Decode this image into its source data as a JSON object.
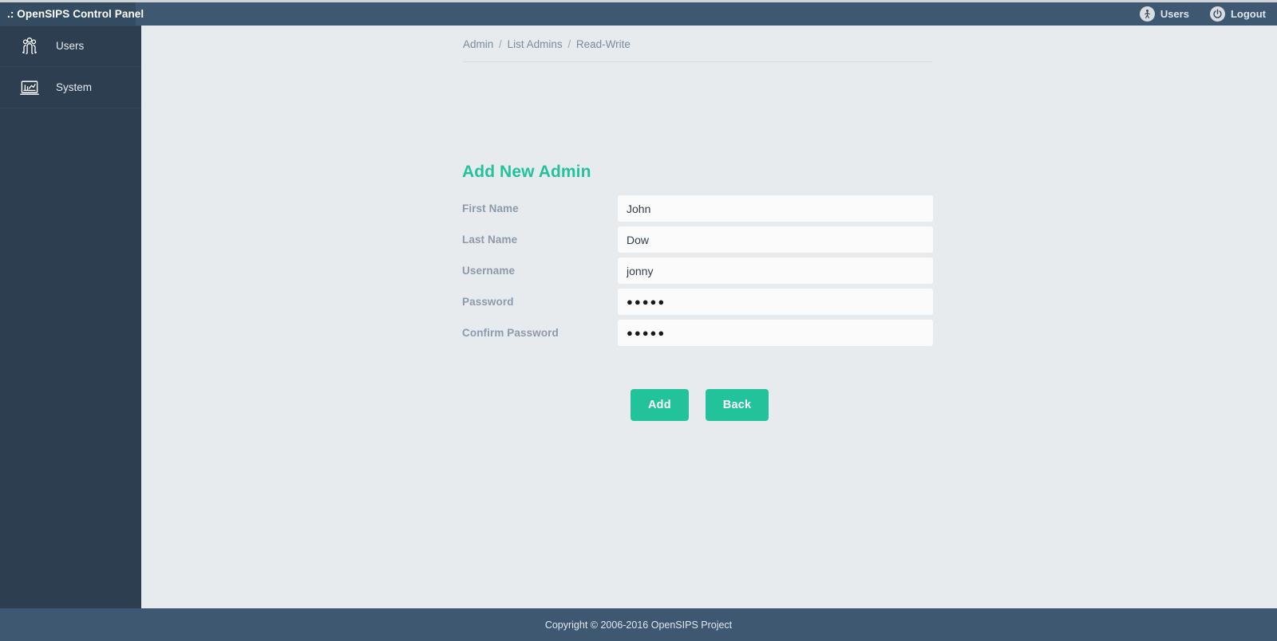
{
  "header": {
    "brand": ".: OpenSIPS Control Panel",
    "users_label": "Users",
    "users_icon": "person-icon",
    "logout_label": "Logout",
    "logout_icon": "power-icon",
    "background_color": "#3d5870",
    "brand_background_color": "#344c61"
  },
  "sidebar": {
    "background_color": "#2c3e50",
    "items": [
      {
        "label": "Users",
        "icon": "users-group-icon"
      },
      {
        "label": "System",
        "icon": "monitor-chart-icon"
      }
    ]
  },
  "breadcrumb": {
    "items": [
      "Admin",
      "List Admins",
      "Read-Write"
    ],
    "separator": "/"
  },
  "main": {
    "title": "Add New Admin",
    "accent_color": "#22c29b",
    "fields": [
      {
        "label": "First Name",
        "value": "John",
        "type": "text",
        "placeholder": ""
      },
      {
        "label": "Last Name",
        "value": "Dow",
        "type": "text",
        "placeholder": ""
      },
      {
        "label": "Username",
        "value": "jonny",
        "type": "text",
        "placeholder": ""
      },
      {
        "label": "Password",
        "value": "●●●●●",
        "type": "password",
        "placeholder": ""
      },
      {
        "label": "Confirm Password",
        "value": "●●●●●",
        "type": "password",
        "placeholder": ""
      }
    ],
    "buttons": [
      {
        "label": "Add",
        "name": "add-button"
      },
      {
        "label": "Back",
        "name": "back-button"
      }
    ]
  },
  "footer": {
    "text": "Copyright © 2006-2016 OpenSIPS Project"
  }
}
